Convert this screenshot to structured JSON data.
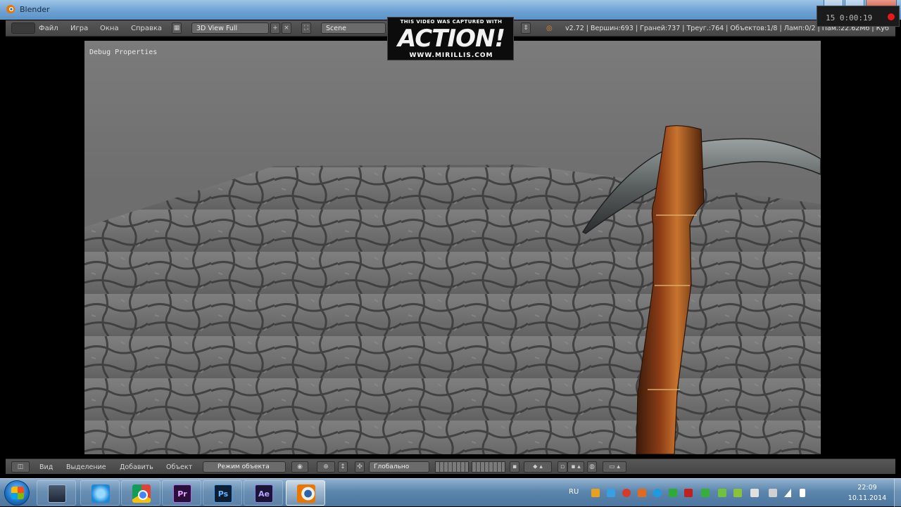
{
  "window": {
    "title": "Blender"
  },
  "header": {
    "menus": [
      "Файл",
      "Игра",
      "Окна",
      "Справка"
    ],
    "screen_layout": "3D View Full",
    "scene": "Scene",
    "stats": "v2.72 | Вершин:693 | Граней:737 | Треуг.:764 | Объектов:1/8 | Ламп:0/2 | Пам.:22.62Мб | Куб"
  },
  "watermark": {
    "top": "THIS VIDEO WAS CAPTURED WITH",
    "logo": "ACTION!",
    "url": "WWW.MIRILLIS.COM"
  },
  "viewport": {
    "debug_label": "Debug Properties"
  },
  "footer": {
    "menus": [
      "Вид",
      "Выделение",
      "Добавить",
      "Объект"
    ],
    "mode": "Режим объекта",
    "shading": "Глобально"
  },
  "taskbar": {
    "apps": [
      {
        "name": "explorer",
        "active": false
      },
      {
        "name": "internet-explorer",
        "active": false
      },
      {
        "name": "chrome",
        "active": false
      },
      {
        "name": "premiere",
        "label": "Pr",
        "active": false
      },
      {
        "name": "photoshop",
        "label": "Ps",
        "active": false
      },
      {
        "name": "after-effects",
        "label": "Ae",
        "active": false
      },
      {
        "name": "blender",
        "active": true
      }
    ],
    "language": "RU",
    "time": "22:09",
    "date": "10.11.2014"
  }
}
